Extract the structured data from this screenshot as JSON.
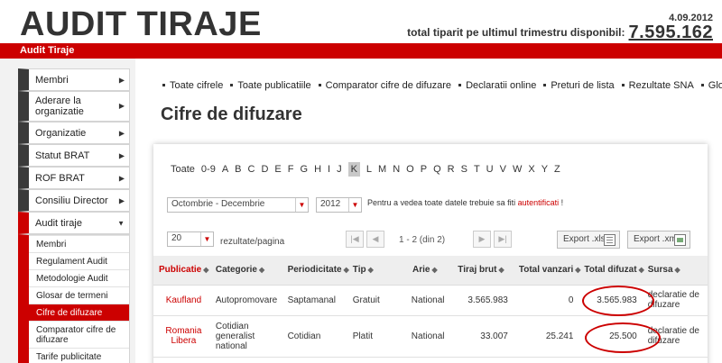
{
  "header": {
    "title": "AUDIT TIRAJE",
    "date": "4.09.2012",
    "total_label": "total tiparit pe ultimul trimestru disponibil:",
    "total_value": "7.595.162",
    "bar_label": "Audit Tiraje"
  },
  "sidebar": {
    "items": [
      {
        "label": "Membri"
      },
      {
        "label": "Aderare la organizatie"
      },
      {
        "label": "Organizatie"
      },
      {
        "label": "Statut BRAT"
      },
      {
        "label": "ROF BRAT"
      },
      {
        "label": "Consiliu Director"
      },
      {
        "label": "Audit tiraje"
      }
    ],
    "subitems": [
      {
        "label": "Membri"
      },
      {
        "label": "Regulament Audit"
      },
      {
        "label": "Metodologie Audit"
      },
      {
        "label": "Glosar de termeni"
      },
      {
        "label": "Cifre de difuzare"
      },
      {
        "label": "Comparator cifre de difuzare"
      },
      {
        "label": "Tarife publicitate"
      }
    ]
  },
  "nav": {
    "links": [
      "Toate cifrele",
      "Toate publicatiile",
      "Comparator cifre de difuzare",
      "Declaratii online",
      "Preturi de lista",
      "Rezultate SNA",
      "Glosar"
    ]
  },
  "page": {
    "title": "Cifre de difuzare"
  },
  "alphabet": [
    "Toate",
    "0-9",
    "A",
    "B",
    "C",
    "D",
    "E",
    "F",
    "G",
    "H",
    "I",
    "J",
    "K",
    "L",
    "M",
    "N",
    "O",
    "P",
    "Q",
    "R",
    "S",
    "T",
    "U",
    "V",
    "W",
    "X",
    "Y",
    "Z"
  ],
  "alphabet_selected": "K",
  "filters": {
    "period": "Octombrie - Decembrie",
    "year": "2012",
    "note_text": "Pentru a vedea toate datele trebuie sa fiti ",
    "note_link": "autentificati",
    "note_end": " !"
  },
  "pager": {
    "per_page": "20",
    "per_page_label": "rezultate/pagina",
    "info": "1 - 2 (din 2)",
    "first": "|◀",
    "prev": "◀",
    "next": "▶",
    "last": "▶|",
    "export_xls": "Export .xls",
    "export_xml": "Export .xml"
  },
  "table": {
    "columns": [
      "Publicatie",
      "Categorie",
      "Periodicitate",
      "Tip",
      "Arie",
      "Tiraj brut",
      "Total vanzari",
      "Total difuzat",
      "Sursa"
    ],
    "rows": [
      [
        "Kaufland",
        "Autopromovare",
        "Saptamanal",
        "Gratuit",
        "National",
        "3.565.983",
        "0",
        "3.565.983",
        "declaratie de difuzare"
      ],
      [
        "Romania Libera",
        "Cotidian generalist national",
        "Cotidian",
        "Platit",
        "National",
        "33.007",
        "25.241",
        "25.500",
        "declaratie de difuzare"
      ]
    ]
  },
  "colors": {
    "accent": "#cc0000",
    "sidebar_dark": "#3a3a3a"
  }
}
